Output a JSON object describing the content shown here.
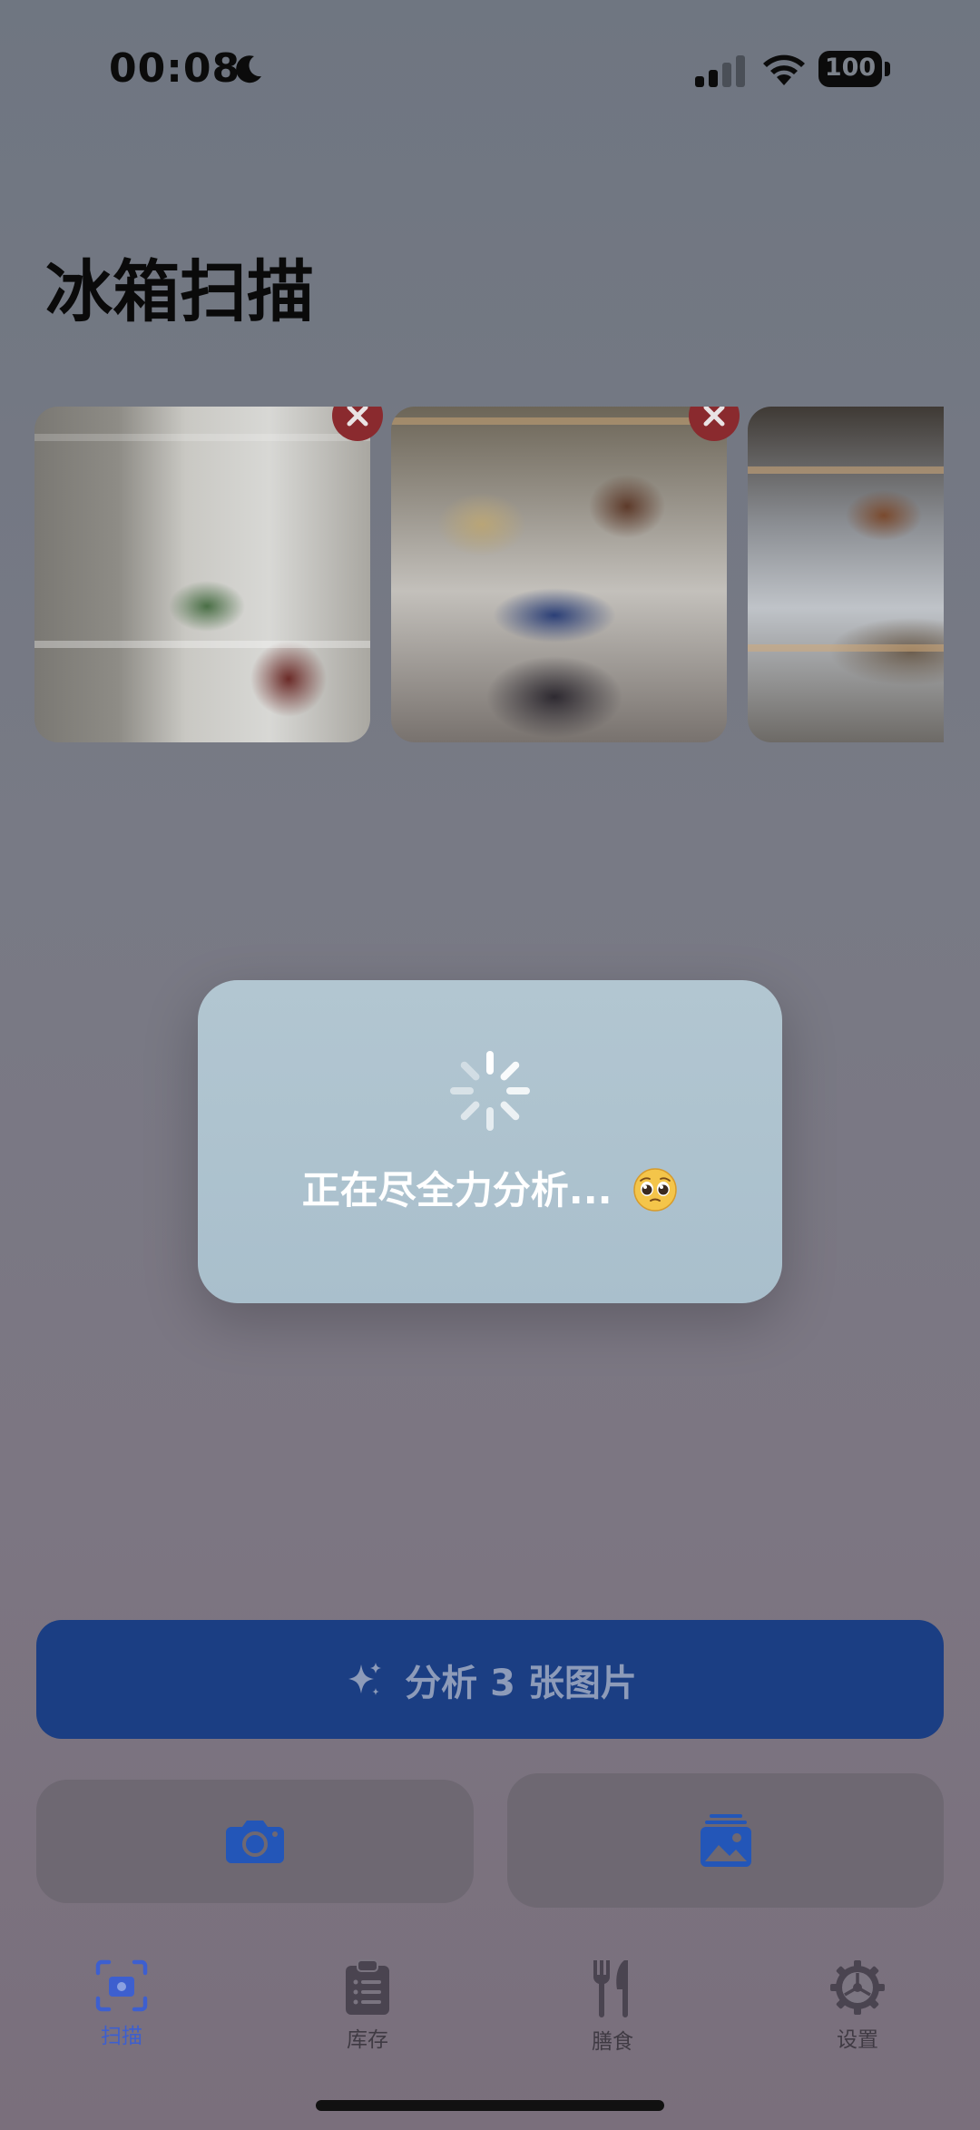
{
  "status_bar": {
    "time": "00:08",
    "battery": "100",
    "icons": [
      "moon-icon",
      "signal-icon",
      "wifi-icon",
      "battery-icon"
    ]
  },
  "page": {
    "title": "冰箱扫描"
  },
  "photos": [
    {
      "label": "fridge-photo-1"
    },
    {
      "label": "fridge-photo-2"
    },
    {
      "label": "fridge-photo-3"
    }
  ],
  "loading": {
    "text": "正在尽全力分析...",
    "emoji": "pleading-face-emoji"
  },
  "analyze_button": {
    "label": "分析 3 张图片",
    "icon": "sparkles-icon"
  },
  "actions": {
    "camera_icon": "camera-icon",
    "library_icon": "photo-library-icon"
  },
  "tabs": [
    {
      "label": "扫描",
      "icon": "scan-icon",
      "active": true
    },
    {
      "label": "库存",
      "icon": "clipboard-icon",
      "active": false
    },
    {
      "label": "膳食",
      "icon": "fork-knife-icon",
      "active": false
    },
    {
      "label": "设置",
      "icon": "gear-icon",
      "active": false
    }
  ],
  "colors": {
    "accent": "#3d5fcf",
    "button": "#1b3e83",
    "remove": "#8a2a2e",
    "dialog": "#b2c6d1"
  }
}
